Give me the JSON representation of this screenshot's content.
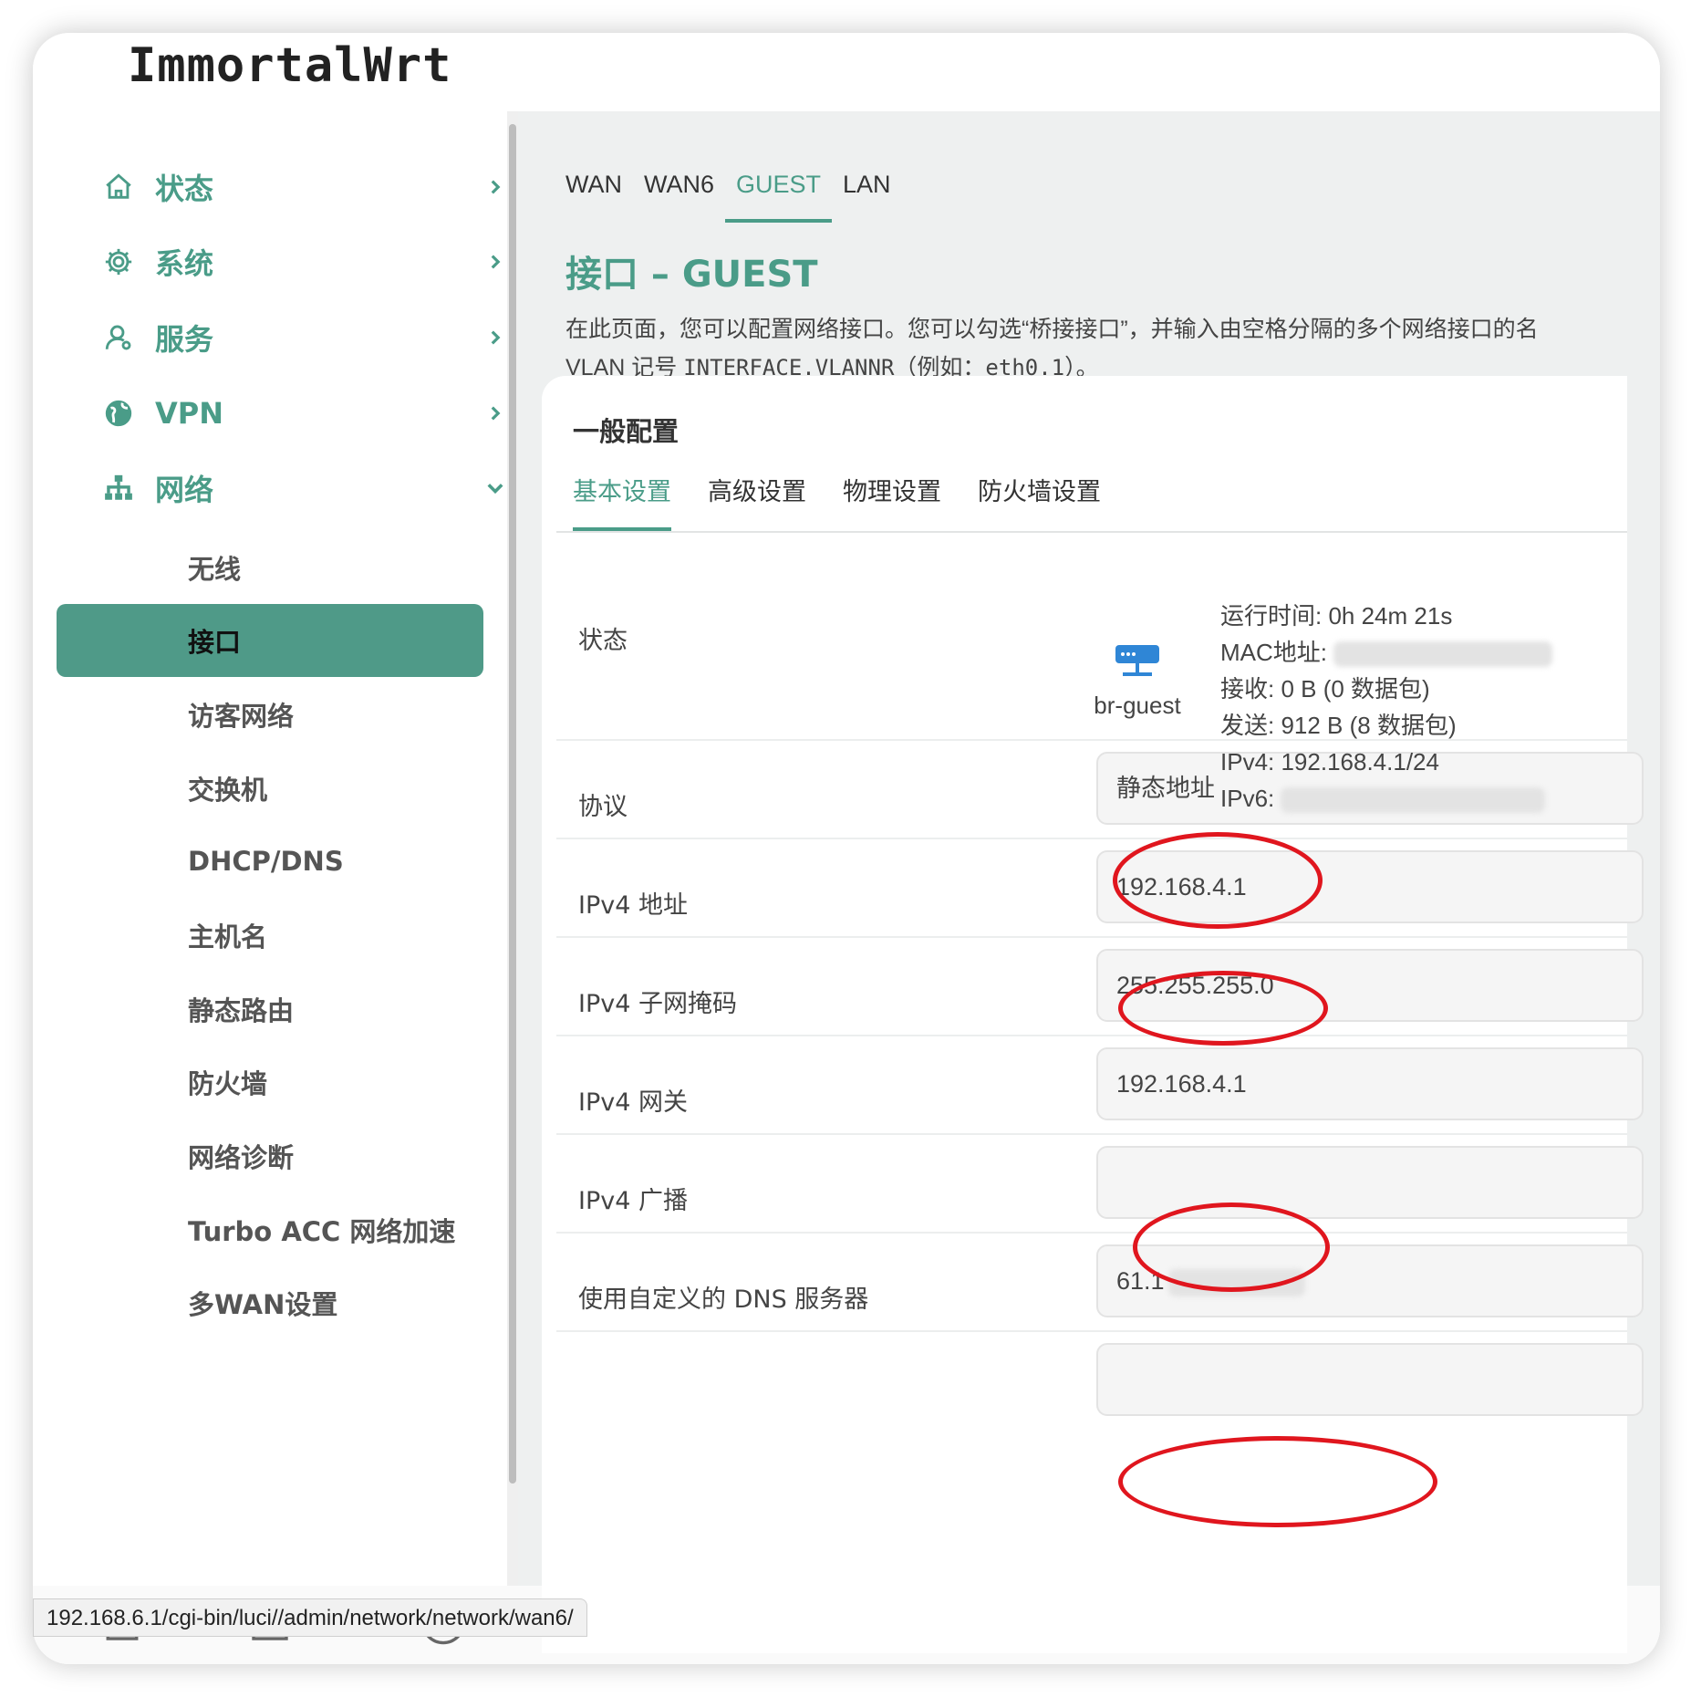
{
  "app": {
    "brand": "ImmortalWrt"
  },
  "sidebar": {
    "top_items": [
      {
        "label": "状态",
        "icon": "home-icon"
      },
      {
        "label": "系统",
        "icon": "gear-icon"
      },
      {
        "label": "服务",
        "icon": "user-service-icon"
      },
      {
        "label": "VPN",
        "icon": "globe-icon"
      },
      {
        "label": "网络",
        "icon": "network-tree-icon"
      }
    ],
    "network_items": [
      "无线",
      "接口",
      "访客网络",
      "交换机",
      "DHCP/DNS",
      "主机名",
      "静态路由",
      "防火墙",
      "网络诊断",
      "Turbo ACC 网络加速",
      "多WAN设置"
    ],
    "active_item": "接口"
  },
  "top_tabs": [
    "WAN",
    "WAN6",
    "GUEST",
    "LAN"
  ],
  "active_top_tab": "GUEST",
  "page": {
    "title": "接口 – GUEST",
    "desc_line1": "在此页面，您可以配置网络接口。您可以勾选“桥接接口”，并输入由空格分隔的多个网络接口的名",
    "desc_vlan": "VLAN",
    "desc_mid": " 记号 ",
    "desc_code1": "INTERFACE.VLANNR",
    "desc_mid2": "（例如：",
    "desc_code2": "eth0.1",
    "desc_end": "）。"
  },
  "card": {
    "title": "一般配置",
    "tabs": [
      "基本设置",
      "高级设置",
      "物理设置",
      "防火墙设置"
    ],
    "active_tab": "基本设置"
  },
  "status": {
    "label": "状态",
    "device": "br-guest",
    "uptime": "运行时间: 0h 24m 21s",
    "mac_label": "MAC地址:",
    "rx": "接收: 0 B (0 数据包)",
    "tx": "发送: 912 B (8 数据包)",
    "ipv4": "IPv4:  192.168.4.1/24",
    "ipv6_label": "IPv6:"
  },
  "fields": [
    {
      "label": "协议",
      "value": "静态地址"
    },
    {
      "label": "IPv4 地址",
      "value": "192.168.4.1"
    },
    {
      "label": "IPv4 子网掩码",
      "value": "255.255.255.0"
    },
    {
      "label": "IPv4 网关",
      "value": "192.168.4.1"
    },
    {
      "label": "IPv4 广播",
      "value": ""
    },
    {
      "label": "使用自定义的 DNS 服务器",
      "value": "61.1"
    }
  ],
  "bottom_nav": [
    "home-icon",
    "cat-icon",
    "link-icon",
    "bar-chart-icon",
    "user-icon"
  ],
  "status_bar_url": "192.168.6.1/cgi-bin/luci//admin/network/network/wan6/",
  "colors": {
    "accent": "#4a9c88",
    "active_bg": "#4f9a88",
    "annotation": "#e0161e"
  }
}
